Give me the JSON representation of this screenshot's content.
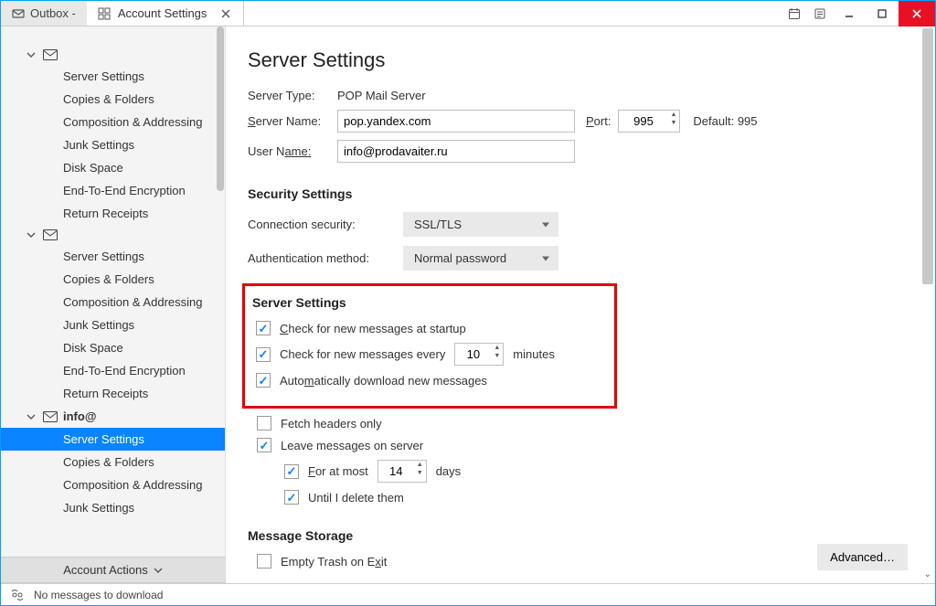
{
  "titlebar": {
    "tab_outbox": "Outbox -",
    "tab_settings": "Account Settings"
  },
  "sidebar": {
    "accounts": [
      {
        "label": "",
        "items": [
          "Server Settings",
          "Copies & Folders",
          "Composition & Addressing",
          "Junk Settings",
          "Disk Space",
          "End-To-End Encryption",
          "Return Receipts"
        ]
      },
      {
        "label": "",
        "items": [
          "Server Settings",
          "Copies & Folders",
          "Composition & Addressing",
          "Junk Settings",
          "Disk Space",
          "End-To-End Encryption",
          "Return Receipts"
        ]
      },
      {
        "label": "info@",
        "items": [
          "Server Settings",
          "Copies & Folders",
          "Composition & Addressing",
          "Junk Settings"
        ]
      }
    ],
    "account_actions": "Account Actions"
  },
  "content": {
    "heading": "Server Settings",
    "server_type_label": "Server Type:",
    "server_type_value": "POP Mail Server",
    "server_name_label_pre": "S",
    "server_name_label_post": "erver Name:",
    "server_name_value": "pop.yandex.com",
    "port_label_pre": "P",
    "port_label_post": "ort:",
    "port_value": "995",
    "default_port": "Default: 995",
    "user_name_label_pre": "User N",
    "user_name_label_post": "ame:",
    "user_name_value": "info@prodavaiter.ru",
    "security_heading": "Security Settings",
    "conn_sec_label": "Connection security:",
    "conn_sec_value": "SSL/TLS",
    "auth_label": "Authentication method:",
    "auth_value": "Normal password",
    "server_settings_heading": "Server Settings",
    "chk_startup_pre": "C",
    "chk_startup_post": "heck for new messages at startup",
    "chk_every_pre": "Check for new messages every",
    "chk_every_value": "10",
    "chk_every_post": "minutes",
    "chk_autodl_pre": "Auto",
    "chk_autodl_mid": "m",
    "chk_autodl_post": "atically download new messages",
    "chk_fetch": "Fetch headers only",
    "chk_leave": "Leave messages on server",
    "chk_atmost_pre": "F",
    "chk_atmost_mid": "or at most",
    "chk_atmost_value": "14",
    "chk_atmost_post": "days",
    "chk_until": "Until I delete them",
    "msg_storage_heading": "Message Storage",
    "chk_empty_pre": "Empty Trash on E",
    "chk_empty_mid": "x",
    "chk_empty_post": "it",
    "advanced_btn": "Advanced…"
  },
  "statusbar": {
    "msg": "No messages to download"
  }
}
